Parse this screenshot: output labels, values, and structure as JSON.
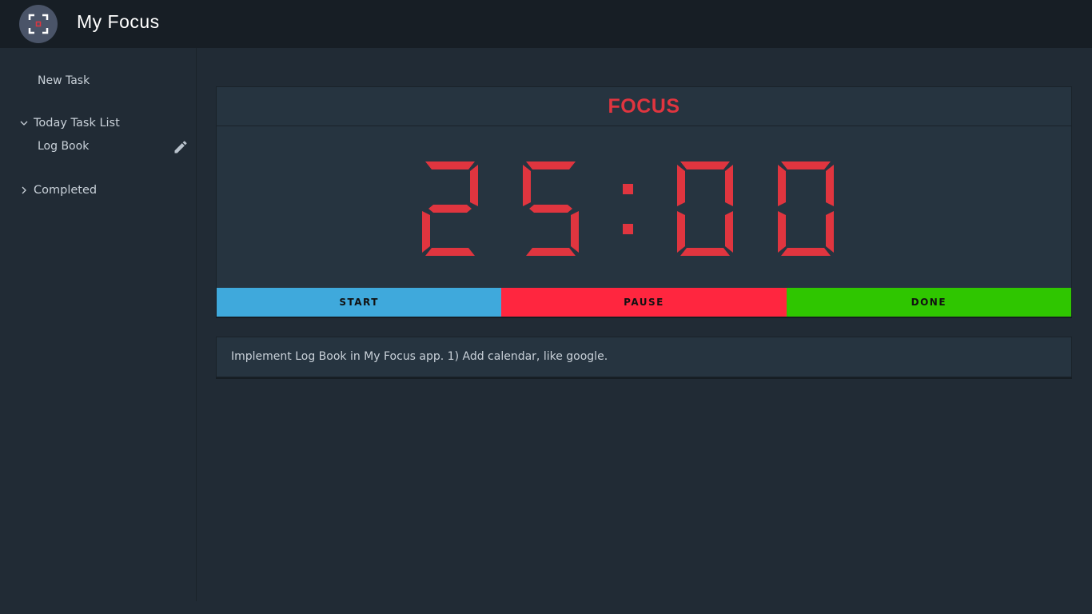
{
  "app": {
    "title": "My Focus",
    "logo_icon": "focus-frame-icon"
  },
  "sidebar": {
    "new_task": "New Task",
    "today_list": {
      "label": "Today Task List",
      "expanded": true,
      "items": [
        {
          "label": "Log Book",
          "icon": "pencil-icon"
        }
      ]
    },
    "completed": {
      "label": "Completed",
      "expanded": false
    }
  },
  "timer": {
    "mode_label": "FOCUS",
    "display": "25:00",
    "digit_color": "#e0353f"
  },
  "controls": {
    "start_label": "START",
    "pause_label": "PAUSE",
    "done_label": "DONE",
    "colors": {
      "start": "#3fa9dc",
      "pause": "#ff263f",
      "done": "#2fc600"
    }
  },
  "task_note": {
    "text": "Implement Log Book in My Focus app. 1) Add calendar, like google."
  }
}
